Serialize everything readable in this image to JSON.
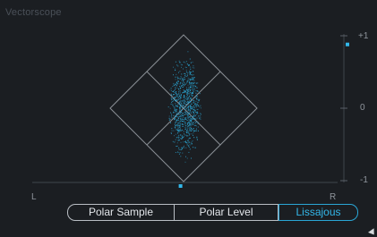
{
  "panel": {
    "title": "Vectorscope"
  },
  "scale": {
    "top": "+1",
    "mid": "0",
    "bottom": "-1",
    "level_marker": 0.88
  },
  "axis": {
    "left": "L",
    "right": "R",
    "balance_marker": -0.02
  },
  "modes": [
    {
      "label": "Polar Sample",
      "active": false
    },
    {
      "label": "Polar Level",
      "active": false
    },
    {
      "label": "Lissajous",
      "active": true
    }
  ],
  "colors": {
    "background": "#1b1e22",
    "grid": "#8a8f95",
    "scope_dots": "#2ba7d5",
    "accent": "#33b8ea"
  },
  "icons": {
    "cursor": "mouse-pointer-icon"
  }
}
